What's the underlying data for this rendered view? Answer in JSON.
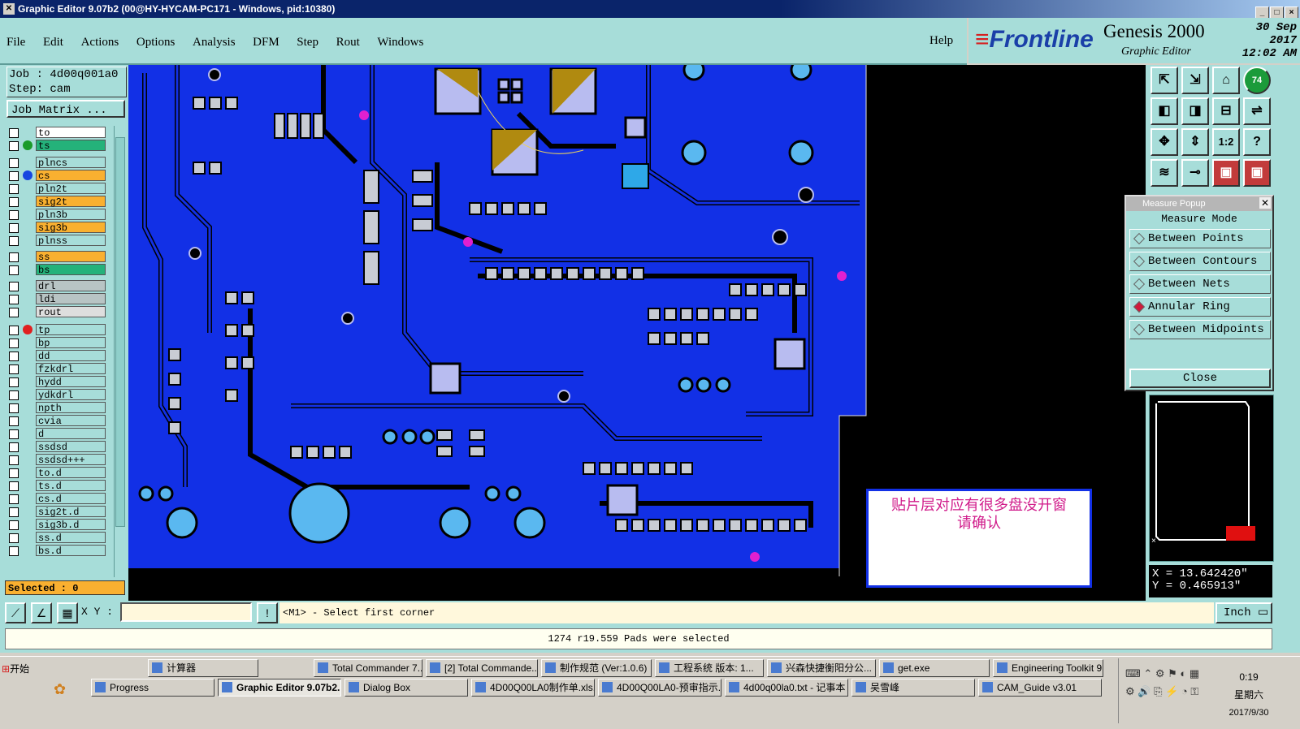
{
  "window": {
    "title": "Graphic Editor 9.07b2 (00@HY-HYCAM-PC171 - Windows, pid:10380)",
    "buttons": [
      "_",
      "□",
      "×"
    ]
  },
  "menu": {
    "items": [
      "File",
      "Edit",
      "Actions",
      "Options",
      "Analysis",
      "DFM",
      "Step",
      "Rout",
      "Windows"
    ],
    "help": "Help"
  },
  "brand": {
    "logo": "Frontline",
    "product": "Genesis 2000",
    "subtitle": "Graphic Editor",
    "date": "30 Sep 2017",
    "time": "12:02 AM"
  },
  "job": {
    "job_line": "Job : 4d00q001a0",
    "step_line": "Step: cam",
    "matrix_button": "Job Matrix ..."
  },
  "layers": [
    {
      "name": "to",
      "color": "#ffffff",
      "dot": "",
      "arrow": true
    },
    {
      "name": "ts",
      "color": "#24b27a",
      "dot": "#1a9b2a",
      "arrow": true
    },
    {
      "name": "plncs",
      "color": "#a7ddd9",
      "dot": "",
      "arrow": false
    },
    {
      "name": "cs",
      "color": "#f9b030",
      "dot": "#1746e0",
      "arrow": true
    },
    {
      "name": "pln2t",
      "color": "#a7ddd9",
      "dot": "",
      "arrow": false
    },
    {
      "name": "sig2t",
      "color": "#f9b030",
      "dot": "",
      "arrow": true
    },
    {
      "name": "pln3b",
      "color": "#a7ddd9",
      "dot": "",
      "arrow": false
    },
    {
      "name": "sig3b",
      "color": "#f9b030",
      "dot": "",
      "arrow": true
    },
    {
      "name": "plnss",
      "color": "#a7ddd9",
      "dot": "",
      "arrow": false
    },
    {
      "name": "ss",
      "color": "#f9b030",
      "dot": "",
      "arrow": true
    },
    {
      "name": "bs",
      "color": "#24b27a",
      "dot": "",
      "arrow": false
    },
    {
      "name": "drl",
      "color": "#b8c4c4",
      "dot": "",
      "arrow": false
    },
    {
      "name": "ldi",
      "color": "#b8c4c4",
      "dot": "",
      "arrow": false
    },
    {
      "name": "rout",
      "color": "#dedede",
      "dot": "",
      "arrow": false
    },
    {
      "name": "tp",
      "color": "#a7ddd9",
      "dot": "#e02020",
      "arrow": true
    },
    {
      "name": "bp",
      "color": "#a7ddd9",
      "dot": "",
      "arrow": false
    },
    {
      "name": "dd",
      "color": "#a7ddd9",
      "dot": "",
      "arrow": true
    },
    {
      "name": "fzkdrl",
      "color": "#a7ddd9",
      "dot": "",
      "arrow": false
    },
    {
      "name": "hydd",
      "color": "#a7ddd9",
      "dot": "",
      "arrow": false
    },
    {
      "name": "ydkdrl",
      "color": "#a7ddd9",
      "dot": "",
      "arrow": false
    },
    {
      "name": "npth",
      "color": "#a7ddd9",
      "dot": "",
      "arrow": false
    },
    {
      "name": "cvia",
      "color": "#a7ddd9",
      "dot": "",
      "arrow": false
    },
    {
      "name": "d",
      "color": "#a7ddd9",
      "dot": "",
      "arrow": false
    },
    {
      "name": "ssdsd",
      "color": "#a7ddd9",
      "dot": "",
      "arrow": false
    },
    {
      "name": "ssdsd+++",
      "color": "#a7ddd9",
      "dot": "",
      "arrow": false
    },
    {
      "name": "to.d",
      "color": "#a7ddd9",
      "dot": "",
      "arrow": true
    },
    {
      "name": "ts.d",
      "color": "#a7ddd9",
      "dot": "",
      "arrow": true
    },
    {
      "name": "cs.d",
      "color": "#a7ddd9",
      "dot": "",
      "arrow": true
    },
    {
      "name": "sig2t.d",
      "color": "#a7ddd9",
      "dot": "",
      "arrow": true
    },
    {
      "name": "sig3b.d",
      "color": "#a7ddd9",
      "dot": "",
      "arrow": true
    },
    {
      "name": "ss.d",
      "color": "#a7ddd9",
      "dot": "",
      "arrow": true
    },
    {
      "name": "bs.d",
      "color": "#a7ddd9",
      "dot": "",
      "arrow": true
    }
  ],
  "selected_label": "Selected : 0",
  "note": {
    "line1": "贴片层对应有很多盘没开窗",
    "line2": "请确认"
  },
  "measure_popup": {
    "title": "Measure Popup",
    "mode_label": "Measure Mode",
    "options": [
      "Between Points",
      "Between Contours",
      "Between Nets",
      "Annular Ring",
      "Between Midpoints"
    ],
    "selected_option": "Annular Ring",
    "close_label": "Close"
  },
  "toolbar_icons": [
    "zoom-home-icon",
    "zoom-out-icon",
    "home-icon",
    "badge-icon",
    "zoom-left-icon",
    "zoom-right-icon",
    "fit-icon",
    "arrow-icon",
    "pan-icon",
    "pan-vertical-icon",
    "scale-icon",
    "help-icon",
    "snap-icon",
    "measure-icon",
    "layer-red-icon",
    "layer-red2-icon"
  ],
  "toolbar_badge": "74",
  "toolbar_scale_label": "1:2",
  "coords": {
    "x": "X = 13.642420\"",
    "y": "Y = 0.465913\""
  },
  "cmdbar": {
    "xy_label": "X Y :",
    "xy_value": "",
    "prompt": "<M1> - Select first corner",
    "units": "Inch"
  },
  "status_message": "1274 r19.559 Pads were selected",
  "taskbar": {
    "start": "开始",
    "row1": [
      "计算器",
      "Total Commander 7....",
      "[2] Total Commande...",
      "制作规范 (Ver:1.0.6)",
      "工程系统  版本: 1...",
      "兴森快捷衡阳分公...",
      "get.exe",
      "Engineering Toolkit 9..."
    ],
    "row2": [
      "Progress",
      "Graphic Editor 9.07b2...",
      "Dialog Box",
      "4D00Q00LA0制作单.xls...",
      "4D00Q00LA0-预审指示...",
      "4d00q00la0.txt - 记事本",
      "吴雪峰",
      "CAM_Guide v3.01"
    ],
    "active": "Graphic Editor 9.07b2...",
    "clock_time": "0:19",
    "clock_day": "星期六",
    "clock_date": "2017/9/30"
  }
}
